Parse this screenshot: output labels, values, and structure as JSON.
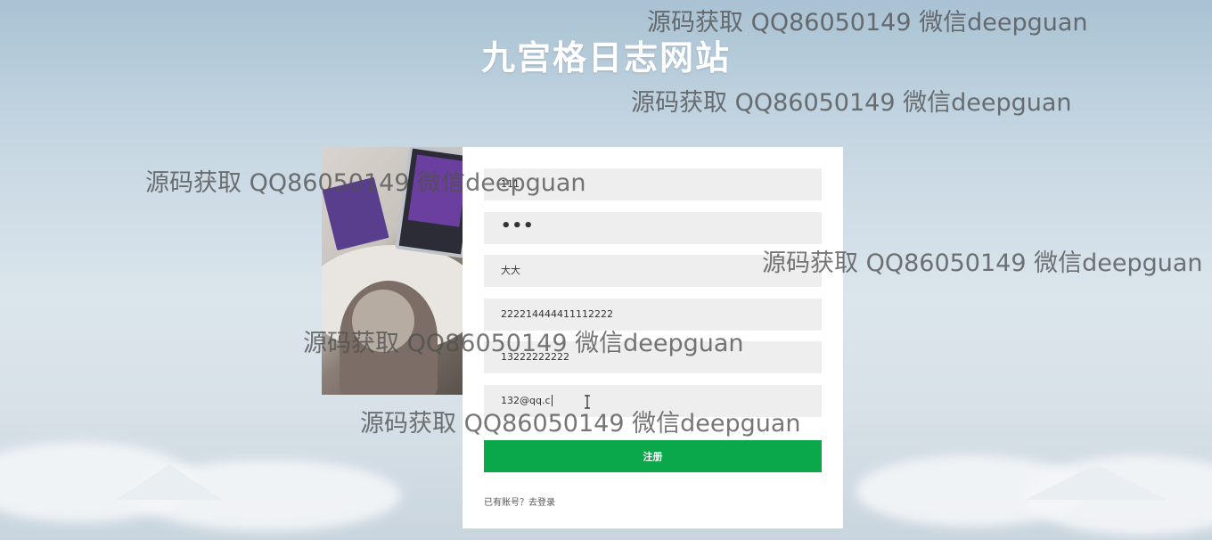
{
  "page_title": "九宫格日志网站",
  "form": {
    "username": "111",
    "password_mask": "•••",
    "nickname": "大大",
    "id_number": "222214444411112222",
    "phone": "13222222222",
    "email": "132@qq.c",
    "submit_label": "注册",
    "login_prompt": "已有账号？去登录"
  },
  "watermark_text": "源码获取 QQ86050149 微信deepguan",
  "colors": {
    "submit": "#0aa84b",
    "field_bg": "#eeeeee",
    "title": "#ffffff"
  }
}
